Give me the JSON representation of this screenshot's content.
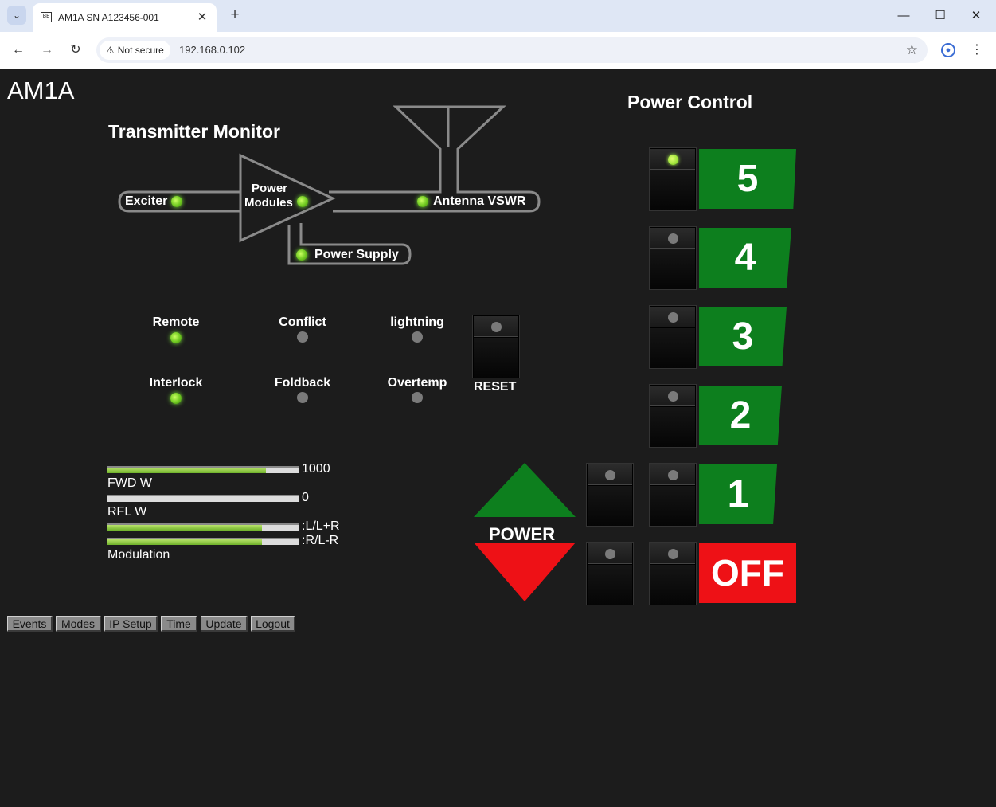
{
  "browser": {
    "tab_title": "AM1A SN A123456-001",
    "favicon_text": "BE",
    "security_label": "Not secure",
    "url": "192.168.0.102",
    "close_symbol": "✕",
    "new_tab_symbol": "+",
    "minimize_symbol": "—",
    "maximize_symbol": "☐",
    "window_close_symbol": "✕",
    "back_symbol": "←",
    "forward_symbol": "→",
    "reload_symbol": "↻",
    "star_symbol": "☆",
    "menu_symbol": "⋮",
    "tab_menu_symbol": "⌄"
  },
  "page": {
    "title": "AM1A",
    "monitor_heading": "Transmitter Monitor",
    "power_heading": "Power Control"
  },
  "diagram": {
    "exciter": "Exciter",
    "power_modules_line1": "Power",
    "power_modules_line2": "Modules",
    "antenna_vswr": "Antenna VSWR",
    "power_supply": "Power Supply",
    "exciter_led": "on",
    "modules_led": "on",
    "vswr_led": "on",
    "supply_led": "on"
  },
  "status": {
    "remote": "Remote",
    "conflict": "Conflict",
    "lightning": "lightning",
    "interlock": "Interlock",
    "foldback": "Foldback",
    "overtemp": "Overtemp",
    "reset": "RESET"
  },
  "meters": {
    "fwd_value": "1000",
    "fwd_label": "FWD W",
    "fwd_level": 0.83,
    "rfl_value": "0",
    "rfl_label": "RFL W",
    "rfl_level": 0,
    "mod_l_value": ":L/L+R",
    "mod_l_level": 0.81,
    "mod_r_value": ":R/L-R",
    "mod_r_level": 0.81,
    "mod_label": "Modulation"
  },
  "power": {
    "label": "POWER",
    "levels": [
      "5",
      "4",
      "3",
      "2",
      "1"
    ],
    "active_level": "5",
    "off_label": "OFF",
    "up_color": "#0d7f1e",
    "down_color": "#ee1116"
  },
  "footer": {
    "buttons": [
      "Events",
      "Modes",
      "IP Setup",
      "Time",
      "Update",
      "Logout"
    ]
  }
}
